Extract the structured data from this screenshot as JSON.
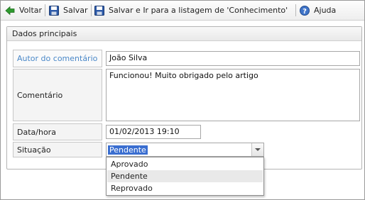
{
  "toolbar": {
    "back_label": "Voltar",
    "save_label": "Salvar",
    "save_list_label": "Salvar e Ir para a listagem de 'Conhecimento'",
    "help_label": "Ajuda"
  },
  "panel": {
    "title": "Dados principais"
  },
  "form": {
    "author_label": "Autor do comentário",
    "author_value": "João Silva",
    "comment_label": "Comentário",
    "comment_value": "Funcionou! Muito obrigado pelo artigo",
    "datetime_label": "Data/hora",
    "datetime_value": "01/02/2013 19:10",
    "status_label": "Situação",
    "status_value": "Pendente",
    "status_options": [
      "Aprovado",
      "Pendente",
      "Reprovado"
    ]
  },
  "colors": {
    "link": "#4a88c8",
    "selection": "#3a6ed0",
    "back_icon": "#2f9a2f",
    "save_icon": "#2d5aa8",
    "help_icon": "#3f74c8"
  },
  "icons": {
    "back": "arrow-left-icon",
    "save": "floppy-disk-icon",
    "save_list": "floppy-disk-icon",
    "help": "help-icon"
  }
}
